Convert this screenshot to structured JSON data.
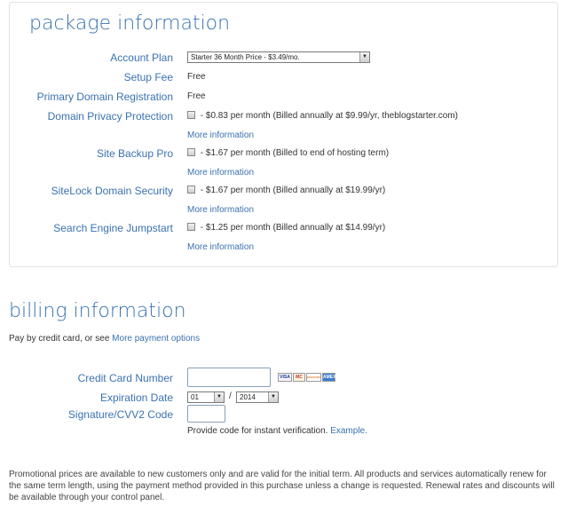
{
  "package": {
    "title": "package information",
    "account_plan": {
      "label": "Account Plan",
      "selected": "Starter 36 Month Price - $3.49/mo."
    },
    "setup_fee": {
      "label": "Setup Fee",
      "value": "Free"
    },
    "primary_domain": {
      "label": "Primary Domain Registration",
      "value": "Free"
    },
    "addons": [
      {
        "label": "Domain Privacy Protection",
        "text": " - $0.83 per month (Billed annually at $9.99/yr, theblogstarter.com)",
        "more": "More information"
      },
      {
        "label": "Site Backup Pro",
        "text": " - $1.67 per month (Billed to end of hosting term)",
        "more": "More information"
      },
      {
        "label": "SiteLock Domain Security",
        "text": " - $1.67 per month (Billed annually at $19.99/yr)",
        "more": "More information"
      },
      {
        "label": "Search Engine Jumpstart",
        "text": " - $1.25 per month (Billed annually at $14.99/yr)",
        "more": "More information"
      }
    ]
  },
  "billing": {
    "title": "billing information",
    "pay_prefix": "Pay by credit card, or see ",
    "pay_link": "More payment options",
    "card_number_label": "Credit Card Number",
    "card_logos": [
      "VISA",
      "MC",
      "DISCOVER",
      "AMEX"
    ],
    "expiration_label": "Expiration Date",
    "exp_month": "01",
    "exp_separator": "/",
    "exp_year": "2014",
    "cvv_label": "Signature/CVV2 Code",
    "cvv_hint_prefix": "Provide code for instant verification. ",
    "cvv_example": "Example."
  },
  "footer": {
    "note": "Promotional prices are available to new customers only and are valid for the initial term. All products and services automatically renew for the same term length, using the payment method provided in this purchase unless a change is requested. Renewal rates and discounts will be available through your control panel."
  },
  "colors": {
    "accent": "#3a72b0",
    "border": "#dfe4ea"
  }
}
